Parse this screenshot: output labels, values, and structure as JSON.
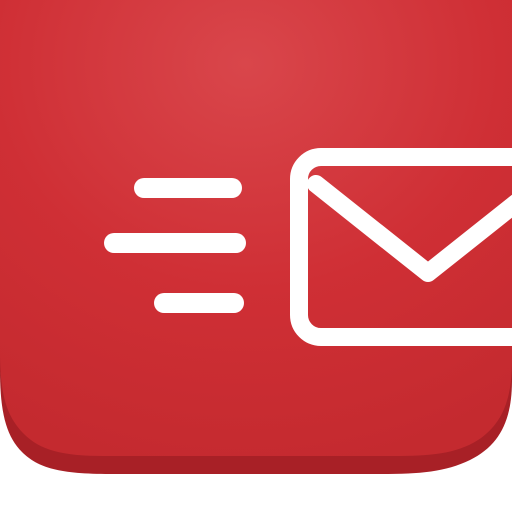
{
  "icon": {
    "name": "mail-send-app-icon",
    "glyphs": [
      "speed-lines-icon",
      "envelope-icon"
    ],
    "colors": {
      "tile_highlight": "#d9464b",
      "tile_base": "#cf2f35",
      "tile_edge": "#c42a2f",
      "tile_shadow": "#a82026",
      "glyph": "#ffffff",
      "background": "#ffffff"
    }
  }
}
